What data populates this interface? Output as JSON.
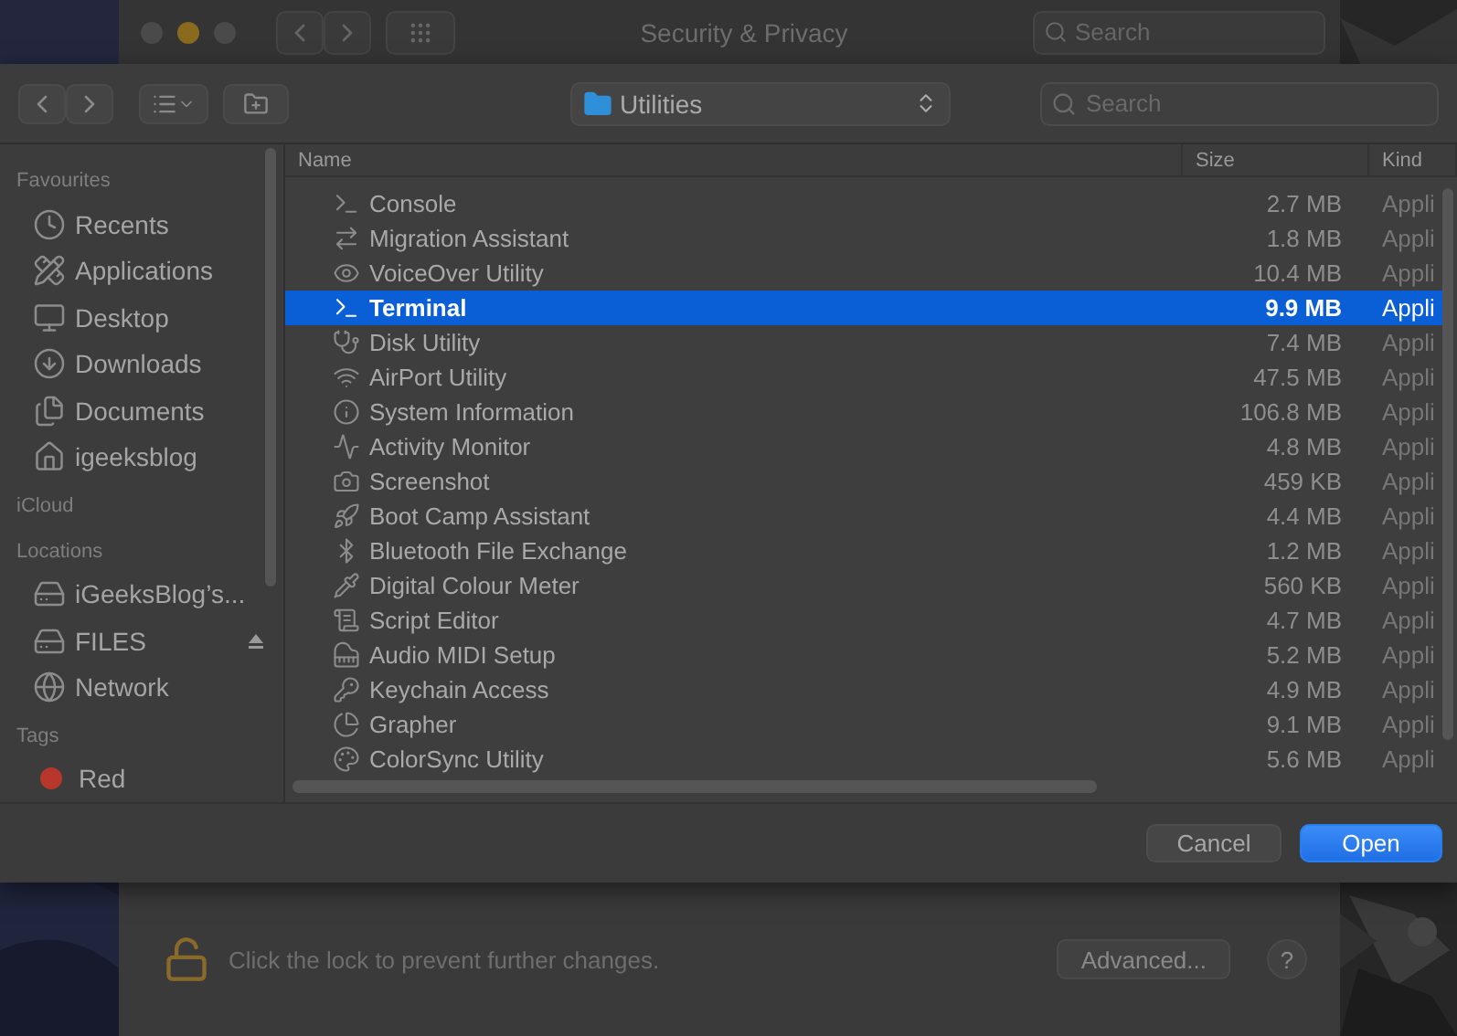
{
  "background_window": {
    "title": "Security & Privacy",
    "search": {
      "placeholder": "Search"
    },
    "lock_message": "Click the lock to prevent further changes.",
    "buttons": [
      {
        "label": "Advanced...",
        "kind": "text"
      },
      {
        "label": "?",
        "kind": "help"
      }
    ]
  },
  "dialog": {
    "location": "Utilities",
    "search": {
      "placeholder": "Search"
    },
    "sidebar": [
      {
        "heading": "Favourites",
        "items": [
          {
            "label": "Recents"
          },
          {
            "label": "Applications"
          },
          {
            "label": "Desktop"
          },
          {
            "label": "Downloads"
          },
          {
            "label": "Documents"
          },
          {
            "label": "igeeksblog"
          }
        ]
      },
      {
        "heading": "iCloud"
      },
      {
        "heading": "Locations",
        "items": [
          {
            "label": "iGeeksBlog’s...",
            "ejectable": false
          },
          {
            "label": "FILES",
            "ejectable": true
          },
          {
            "label": "Network",
            "ejectable": false
          }
        ]
      },
      {
        "heading": "Tags",
        "items": [
          {
            "label": "Red",
            "color": "#b8372d"
          }
        ]
      }
    ],
    "table": {
      "columns": [
        "Name",
        "Size",
        "Kind"
      ],
      "rows": [
        {
          "name": "Console",
          "size": "2.7 MB",
          "kind": "Appli",
          "selected": false
        },
        {
          "name": "Migration Assistant",
          "size": "1.8 MB",
          "kind": "Appli",
          "selected": false
        },
        {
          "name": "VoiceOver Utility",
          "size": "10.4 MB",
          "kind": "Appli",
          "selected": false
        },
        {
          "name": "Terminal",
          "size": "9.9 MB",
          "kind": "Appli",
          "selected": true
        },
        {
          "name": "Disk Utility",
          "size": "7.4 MB",
          "kind": "Appli",
          "selected": false
        },
        {
          "name": "AirPort Utility",
          "size": "47.5 MB",
          "kind": "Appli",
          "selected": false
        },
        {
          "name": "System Information",
          "size": "106.8 MB",
          "kind": "Appli",
          "selected": false
        },
        {
          "name": "Activity Monitor",
          "size": "4.8 MB",
          "kind": "Appli",
          "selected": false
        },
        {
          "name": "Screenshot",
          "size": "459 KB",
          "kind": "Appli",
          "selected": false
        },
        {
          "name": "Boot Camp Assistant",
          "size": "4.4 MB",
          "kind": "Appli",
          "selected": false
        },
        {
          "name": "Bluetooth File Exchange",
          "size": "1.2 MB",
          "kind": "Appli",
          "selected": false
        },
        {
          "name": "Digital Colour Meter",
          "size": "560 KB",
          "kind": "Appli",
          "selected": false
        },
        {
          "name": "Script Editor",
          "size": "4.7 MB",
          "kind": "Appli",
          "selected": false
        },
        {
          "name": "Audio MIDI Setup",
          "size": "5.2 MB",
          "kind": "Appli",
          "selected": false
        },
        {
          "name": "Keychain Access",
          "size": "4.9 MB",
          "kind": "Appli",
          "selected": false
        },
        {
          "name": "Grapher",
          "size": "9.1 MB",
          "kind": "Appli",
          "selected": false
        },
        {
          "name": "ColorSync Utility",
          "size": "5.6 MB",
          "kind": "Appli",
          "selected": false
        }
      ]
    },
    "buttons": [
      {
        "label": "Cancel",
        "kind": "secondary"
      },
      {
        "label": "Open",
        "kind": "default"
      }
    ]
  }
}
